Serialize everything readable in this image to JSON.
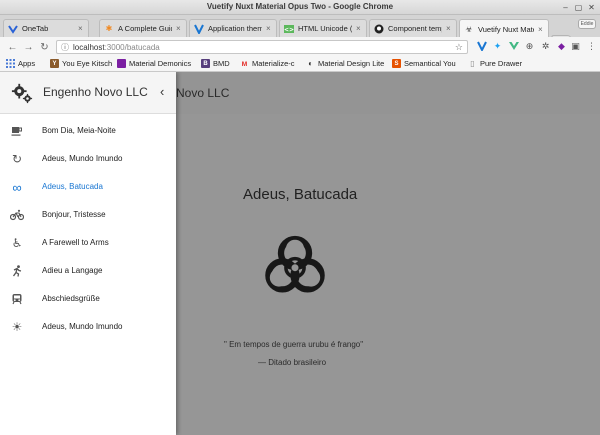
{
  "window": {
    "title": "Vuetify Nuxt Material Opus Two - Google Chrome"
  },
  "tabs": [
    {
      "label": "OneTab",
      "icon": "onetab-icon",
      "icon_color": "#2a62d6"
    },
    {
      "label": "A Complete Guid",
      "icon": "asterisk-icon",
      "icon_color": "#f08a24"
    },
    {
      "label": "Application them",
      "icon": "vuetify-icon",
      "icon_color": "#1976d2"
    },
    {
      "label": "HTML Unicode (U",
      "icon": "html-icon",
      "icon_color": "#5cb85c"
    },
    {
      "label": "Component temp",
      "icon": "github-icon",
      "icon_color": "#222222"
    },
    {
      "label": "Vuetify Nuxt Mate",
      "icon": "biohazard-icon",
      "icon_color": "#333333"
    }
  ],
  "profile_label": "Eddie",
  "address": {
    "host": "localhost",
    "path": ":3000/batucada"
  },
  "bookmarks": [
    {
      "label": "Apps",
      "icon": "apps-icon",
      "color": "#4a7bd6"
    },
    {
      "label": "You Eye Kitsch",
      "icon": "yeti-icon",
      "color": "#8a5a2a"
    },
    {
      "label": "Material Demonics",
      "icon": "material-icon",
      "color": "#7b1fa2"
    },
    {
      "label": "BMD",
      "icon": "bootstrap-icon",
      "color": "#563d7c"
    },
    {
      "label": "Materialize-c",
      "icon": "materialize-icon",
      "color": "#e53935"
    },
    {
      "label": "Material Design Lite",
      "icon": "mdl-icon",
      "color": "#333333"
    },
    {
      "label": "Semantical You",
      "icon": "semantic-icon",
      "color": "#e65100"
    },
    {
      "label": "Pure Drawer",
      "icon": "document-icon",
      "color": "#888888"
    }
  ],
  "app": {
    "toolbar_title": "Novo LLC",
    "quote_title": "Adeus, Batucada",
    "quote": "\" Em tempos de guerra urubu é frango\"",
    "author": "—  Ditado brasileiro"
  },
  "drawer": {
    "title": "Engenho Novo LLC",
    "items": [
      {
        "label": "Bom Dia, Meia-Noite",
        "icon": "coffee-icon"
      },
      {
        "label": "Adeus, Mundo Imundo",
        "icon": "cached-icon"
      },
      {
        "label": "Adeus, Batucada",
        "icon": "infinity-icon"
      },
      {
        "label": "Bonjour, Tristesse",
        "icon": "bike-icon"
      },
      {
        "label": "A Farewell to Arms",
        "icon": "accessible-icon"
      },
      {
        "label": "Adieu a Langage",
        "icon": "run-icon"
      },
      {
        "label": "Abschiedsgrüße",
        "icon": "train-icon"
      },
      {
        "label": "Adeus, Mundo Imundo",
        "icon": "sun-icon"
      }
    ],
    "active_index": 2,
    "active_color": "#1976d2"
  }
}
